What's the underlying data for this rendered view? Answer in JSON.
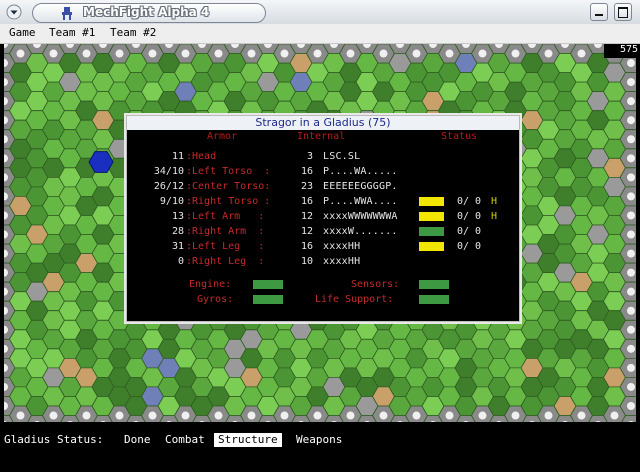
{
  "window": {
    "title": "MechFight Alpha 4"
  },
  "menu": [
    {
      "label": "Game"
    },
    {
      "label": "Team #1"
    },
    {
      "label": "Team #2"
    }
  ],
  "map": {
    "turn_counter": "575"
  },
  "dialog": {
    "title": "Stragor in a Gladius (75)",
    "headers": {
      "armor": "Armor",
      "internal": "Internal",
      "status": "Status"
    },
    "locations": [
      {
        "armor": "11",
        "name": ":Head",
        "internal": "3",
        "crits": "LSC.SL",
        "status_color": "",
        "ammo": "",
        "heat": ""
      },
      {
        "armor": "34/10",
        "name": ":Left Torso  :",
        "internal": "16",
        "crits": "P....WA.....",
        "status_color": "",
        "ammo": "",
        "heat": ""
      },
      {
        "armor": "26/12",
        "name": ":Center Torso:",
        "internal": "23",
        "crits": "EEEEEEGGGGP.",
        "status_color": "",
        "ammo": "",
        "heat": ""
      },
      {
        "armor": "9/10",
        "name": ":Right Torso :",
        "internal": "16",
        "crits": "P....WWA....",
        "status_color": "#f2e600",
        "ammo": "0/ 0",
        "heat": "H"
      },
      {
        "armor": "13",
        "name": ":Left Arm   :",
        "internal": "12",
        "crits": "xxxxWWWWWWWA",
        "status_color": "#f2e600",
        "ammo": "0/ 0",
        "heat": "H"
      },
      {
        "armor": "28",
        "name": ":Right Arm  :",
        "internal": "12",
        "crits": "xxxxW.......",
        "status_color": "#3d9a43",
        "ammo": "0/ 0",
        "heat": ""
      },
      {
        "armor": "31",
        "name": ":Left Leg   :",
        "internal": "16",
        "crits": "xxxxHH",
        "status_color": "#f2e600",
        "ammo": "0/ 0",
        "heat": ""
      },
      {
        "armor": "0",
        "name": ":Right Leg  :",
        "internal": "10",
        "crits": "xxxxHH",
        "status_color": "",
        "ammo": "",
        "heat": ""
      }
    ],
    "systems": {
      "engine": "Engine:",
      "gyros": "Gyros:",
      "sensors": "Sensors:",
      "life_support": "Life Support:",
      "bar_color": "#3d9a43"
    }
  },
  "status_bar": {
    "label": "Gladius Status:",
    "tabs": [
      {
        "label": "Done"
      },
      {
        "label": "Combat"
      },
      {
        "label": "Structure"
      },
      {
        "label": "Weapons"
      }
    ],
    "active_tab": "Structure"
  }
}
